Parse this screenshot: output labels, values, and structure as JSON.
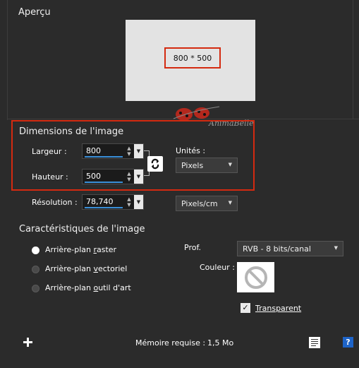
{
  "preview": {
    "title": "Aperçu",
    "size_label": "800 * 500",
    "watermark": "AnimaBelle"
  },
  "dimensions": {
    "title": "Dimensions de l'image",
    "width_label": "Largeur :",
    "width_value": "800",
    "height_label": "Hauteur :",
    "height_value": "500",
    "units_label": "Unités :",
    "units_value": "Pixels",
    "resolution_label": "Résolution :",
    "resolution_value": "78,740",
    "resolution_unit": "Pixels/cm"
  },
  "characteristics": {
    "title": "Caractéristiques de l'image",
    "background_options": [
      {
        "pre": "Arrière-plan ",
        "u": "r",
        "post": "aster",
        "selected": true
      },
      {
        "pre": "Arrière-plan ",
        "u": "v",
        "post": "ectoriel",
        "selected": false
      },
      {
        "pre": "Arrière-plan ",
        "u": "o",
        "post": "util d'art",
        "selected": false
      }
    ],
    "depth_label": "Prof.",
    "depth_value": "RVB - 8 bits/canal",
    "color_label": "Couleur :",
    "transparent_label": "Transparent",
    "transparent_checked": true
  },
  "footer": {
    "memory_label": "Mémoire requise :",
    "memory_value": "1,5 Mo"
  },
  "colors": {
    "accent_red": "#d42a10",
    "accent_blue": "#3a8fd8",
    "panel_bg": "#2b2b2b"
  }
}
